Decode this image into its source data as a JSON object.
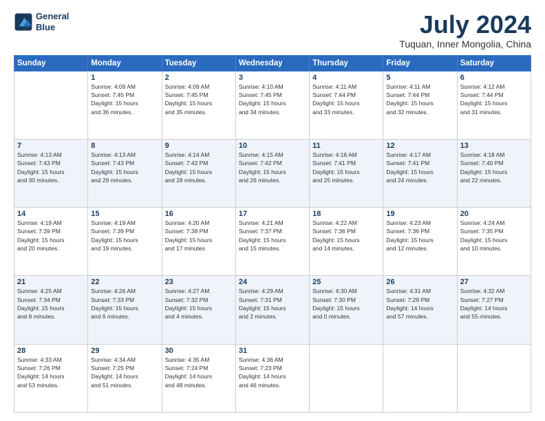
{
  "header": {
    "logo_line1": "General",
    "logo_line2": "Blue",
    "month": "July 2024",
    "location": "Tuquan, Inner Mongolia, China"
  },
  "days_of_week": [
    "Sunday",
    "Monday",
    "Tuesday",
    "Wednesday",
    "Thursday",
    "Friday",
    "Saturday"
  ],
  "weeks": [
    [
      {
        "num": "",
        "info": ""
      },
      {
        "num": "1",
        "info": "Sunrise: 4:09 AM\nSunset: 7:45 PM\nDaylight: 15 hours\nand 36 minutes."
      },
      {
        "num": "2",
        "info": "Sunrise: 4:09 AM\nSunset: 7:45 PM\nDaylight: 15 hours\nand 35 minutes."
      },
      {
        "num": "3",
        "info": "Sunrise: 4:10 AM\nSunset: 7:45 PM\nDaylight: 15 hours\nand 34 minutes."
      },
      {
        "num": "4",
        "info": "Sunrise: 4:11 AM\nSunset: 7:44 PM\nDaylight: 15 hours\nand 33 minutes."
      },
      {
        "num": "5",
        "info": "Sunrise: 4:11 AM\nSunset: 7:44 PM\nDaylight: 15 hours\nand 32 minutes."
      },
      {
        "num": "6",
        "info": "Sunrise: 4:12 AM\nSunset: 7:44 PM\nDaylight: 15 hours\nand 31 minutes."
      }
    ],
    [
      {
        "num": "7",
        "info": "Sunrise: 4:13 AM\nSunset: 7:43 PM\nDaylight: 15 hours\nand 30 minutes."
      },
      {
        "num": "8",
        "info": "Sunrise: 4:13 AM\nSunset: 7:43 PM\nDaylight: 15 hours\nand 29 minutes."
      },
      {
        "num": "9",
        "info": "Sunrise: 4:14 AM\nSunset: 7:42 PM\nDaylight: 15 hours\nand 28 minutes."
      },
      {
        "num": "10",
        "info": "Sunrise: 4:15 AM\nSunset: 7:42 PM\nDaylight: 15 hours\nand 26 minutes."
      },
      {
        "num": "11",
        "info": "Sunrise: 4:16 AM\nSunset: 7:41 PM\nDaylight: 15 hours\nand 25 minutes."
      },
      {
        "num": "12",
        "info": "Sunrise: 4:17 AM\nSunset: 7:41 PM\nDaylight: 15 hours\nand 24 minutes."
      },
      {
        "num": "13",
        "info": "Sunrise: 4:18 AM\nSunset: 7:40 PM\nDaylight: 15 hours\nand 22 minutes."
      }
    ],
    [
      {
        "num": "14",
        "info": "Sunrise: 4:19 AM\nSunset: 7:39 PM\nDaylight: 15 hours\nand 20 minutes."
      },
      {
        "num": "15",
        "info": "Sunrise: 4:19 AM\nSunset: 7:39 PM\nDaylight: 15 hours\nand 19 minutes."
      },
      {
        "num": "16",
        "info": "Sunrise: 4:20 AM\nSunset: 7:38 PM\nDaylight: 15 hours\nand 17 minutes."
      },
      {
        "num": "17",
        "info": "Sunrise: 4:21 AM\nSunset: 7:37 PM\nDaylight: 15 hours\nand 15 minutes."
      },
      {
        "num": "18",
        "info": "Sunrise: 4:22 AM\nSunset: 7:36 PM\nDaylight: 15 hours\nand 14 minutes."
      },
      {
        "num": "19",
        "info": "Sunrise: 4:23 AM\nSunset: 7:36 PM\nDaylight: 15 hours\nand 12 minutes."
      },
      {
        "num": "20",
        "info": "Sunrise: 4:24 AM\nSunset: 7:35 PM\nDaylight: 15 hours\nand 10 minutes."
      }
    ],
    [
      {
        "num": "21",
        "info": "Sunrise: 4:25 AM\nSunset: 7:34 PM\nDaylight: 15 hours\nand 8 minutes."
      },
      {
        "num": "22",
        "info": "Sunrise: 4:26 AM\nSunset: 7:33 PM\nDaylight: 15 hours\nand 6 minutes."
      },
      {
        "num": "23",
        "info": "Sunrise: 4:27 AM\nSunset: 7:32 PM\nDaylight: 15 hours\nand 4 minutes."
      },
      {
        "num": "24",
        "info": "Sunrise: 4:29 AM\nSunset: 7:31 PM\nDaylight: 15 hours\nand 2 minutes."
      },
      {
        "num": "25",
        "info": "Sunrise: 4:30 AM\nSunset: 7:30 PM\nDaylight: 15 hours\nand 0 minutes."
      },
      {
        "num": "26",
        "info": "Sunrise: 4:31 AM\nSunset: 7:29 PM\nDaylight: 14 hours\nand 57 minutes."
      },
      {
        "num": "27",
        "info": "Sunrise: 4:32 AM\nSunset: 7:27 PM\nDaylight: 14 hours\nand 55 minutes."
      }
    ],
    [
      {
        "num": "28",
        "info": "Sunrise: 4:33 AM\nSunset: 7:26 PM\nDaylight: 14 hours\nand 53 minutes."
      },
      {
        "num": "29",
        "info": "Sunrise: 4:34 AM\nSunset: 7:25 PM\nDaylight: 14 hours\nand 51 minutes."
      },
      {
        "num": "30",
        "info": "Sunrise: 4:35 AM\nSunset: 7:24 PM\nDaylight: 14 hours\nand 48 minutes."
      },
      {
        "num": "31",
        "info": "Sunrise: 4:36 AM\nSunset: 7:23 PM\nDaylight: 14 hours\nand 46 minutes."
      },
      {
        "num": "",
        "info": ""
      },
      {
        "num": "",
        "info": ""
      },
      {
        "num": "",
        "info": ""
      }
    ]
  ]
}
